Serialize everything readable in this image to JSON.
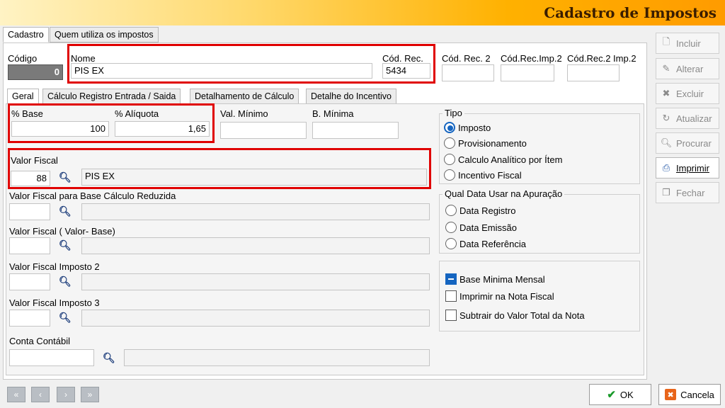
{
  "window": {
    "title": "Cadastro de Impostos"
  },
  "top_tabs": [
    "Cadastro",
    "Quem utiliza os impostos"
  ],
  "header": {
    "codigo_label": "Código",
    "codigo_value": "0",
    "nome_label": "Nome",
    "nome_value": "PIS EX",
    "cod_rec_label": "Cód. Rec.",
    "cod_rec_value": "5434",
    "cod_rec2_label": "Cód. Rec. 2",
    "cod_rec2_value": "",
    "cod_rec_imp2_label": "Cód.Rec.Imp.2",
    "cod_rec_imp2_value": "",
    "cod_rec2_imp2_label": "Cód.Rec.2 Imp.2",
    "cod_rec2_imp2_value": ""
  },
  "inner_tabs": [
    "Geral",
    "Cálculo Registro Entrada / Saida",
    "Detalhamento de Cálculo",
    "Detalhe do Incentivo"
  ],
  "geral": {
    "base_label": "% Base",
    "base_value": "100",
    "aliquota_label": "% Alíquota",
    "aliquota_value": "1,65",
    "val_minimo_label": "Val. Mínimo",
    "val_minimo_value": "",
    "b_minima_label": "B. Mínima",
    "b_minima_value": "",
    "valor_fiscal_label": "Valor Fiscal",
    "valor_fiscal_code": "88",
    "valor_fiscal_desc": "PIS EX",
    "vf_base_reduzida_label": "Valor Fiscal para Base Cálculo Reduzida",
    "vf_valor_base_label": "Valor Fiscal ( Valor- Base)",
    "vf_imposto2_label": "Valor Fiscal Imposto 2",
    "vf_imposto3_label": "Valor Fiscal Imposto 3",
    "conta_contabil_label": "Conta Contábil"
  },
  "tipo": {
    "title": "Tipo",
    "options": [
      "Imposto",
      "Provisionamento",
      "Calculo Analítico por Ítem",
      "Incentivo Fiscal"
    ],
    "selected": 0
  },
  "data_apuracao": {
    "title": "Qual Data Usar na Apuração",
    "options": [
      "Data Registro",
      "Data Emissão",
      "Data Referência"
    ]
  },
  "checks": [
    {
      "label": "Base Minima Mensal",
      "checked": true
    },
    {
      "label": "Imprimir na Nota Fiscal",
      "checked": false
    },
    {
      "label": "Subtrair do Valor Total da Nota",
      "checked": false
    }
  ],
  "side_buttons": [
    {
      "label": "Incluir",
      "icon": "document-icon",
      "enabled": false
    },
    {
      "label": "Alterar",
      "icon": "edit-icon",
      "enabled": false
    },
    {
      "label": "Excluir",
      "icon": "delete-icon",
      "enabled": false
    },
    {
      "label": "Atualizar",
      "icon": "refresh-icon",
      "enabled": false
    },
    {
      "label": "Procurar",
      "icon": "binoculars-icon",
      "enabled": false
    },
    {
      "label": "Imprimir",
      "icon": "printer-icon",
      "enabled": true
    },
    {
      "label": "Fechar",
      "icon": "close-doc-icon",
      "enabled": false
    }
  ],
  "bottom": {
    "ok_label": "OK",
    "cancel_label": "Cancela"
  },
  "nav": {
    "first": "«",
    "prev": "‹",
    "next": "›",
    "last": "»"
  },
  "colors": {
    "highlight": "#e00000",
    "accent": "#1565c0",
    "title_bar": "#ffb100"
  }
}
